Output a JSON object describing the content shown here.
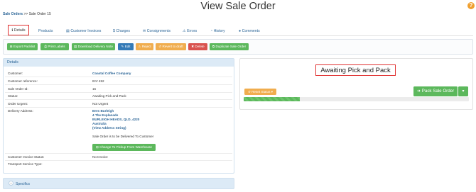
{
  "header": {
    "title": "View Sale Order",
    "help_label": "?"
  },
  "breadcrumb": {
    "parent": "Sale Orders",
    "separator": ">>",
    "current": "Sale Order 15"
  },
  "tabs": [
    {
      "label": "Details",
      "icon": "info-icon",
      "active": true
    },
    {
      "label": "Products",
      "icon": ""
    },
    {
      "label": "Customer Invoices",
      "icon": "file-icon"
    },
    {
      "label": "Charges",
      "icon": "dollar-icon"
    },
    {
      "label": "Consignments",
      "icon": "envelope-icon"
    },
    {
      "label": "Errors",
      "icon": "warning-icon"
    },
    {
      "label": "History",
      "icon": "clock-icon"
    },
    {
      "label": "Comments",
      "icon": "comment-icon"
    }
  ],
  "toolbar": {
    "export_packlist": "Export Packlist",
    "print_labels": "Print Labels",
    "download_delivery_note": "Download Delivery Note",
    "edit": "Edit",
    "reject": "Reject",
    "revert_to_draft": "Revert to draft",
    "delete": "Delete",
    "duplicate": "Duplicate Sale Order"
  },
  "details": {
    "heading": "Details",
    "customer_label": "Customer:",
    "customer_value": "Coastal Coffee Company",
    "customer_reference_label": "Customer reference:",
    "customer_reference_value": "INV 452",
    "sale_order_id_label": "Sale Order Id:",
    "sale_order_id_value": "15",
    "status_label": "Status:",
    "status_value": "Awaiting Pick and Pack",
    "order_urgent_label": "Order Urgent:",
    "order_urgent_value": "Not Urgent",
    "delivery_address_label": "Delivery Address:",
    "address_lines": [
      "Bres Burleigh",
      "4 The Esplanade",
      "BURLEIGH HEADS, QLD, 4220",
      "Australia",
      "(View Address String)"
    ],
    "delivery_note": "Sale Order is to be Delivered To Customer",
    "change_pickup_button": "Change To Pickup From Warehouse",
    "customer_invoice_status_label": "Customer Invoice Status:",
    "customer_invoice_status_value": "No Invoice",
    "transport_service_type_label": "Transport Service Type:",
    "transport_service_type_value": ""
  },
  "status_panel": {
    "status_text": "Awaiting Pick and Pack",
    "progress": 0.25,
    "reset_status_button": "Reset Status",
    "pack_sale_order_button": "Pack Sale Order"
  },
  "specifics": {
    "label": "Specifics",
    "toggle": "+"
  },
  "colors": {
    "green": "#5cb85c",
    "blue": "#337ab7",
    "orange": "#f0ad4e",
    "red": "#d9534f",
    "link": "#2a6496",
    "highlight": "#e03030"
  }
}
